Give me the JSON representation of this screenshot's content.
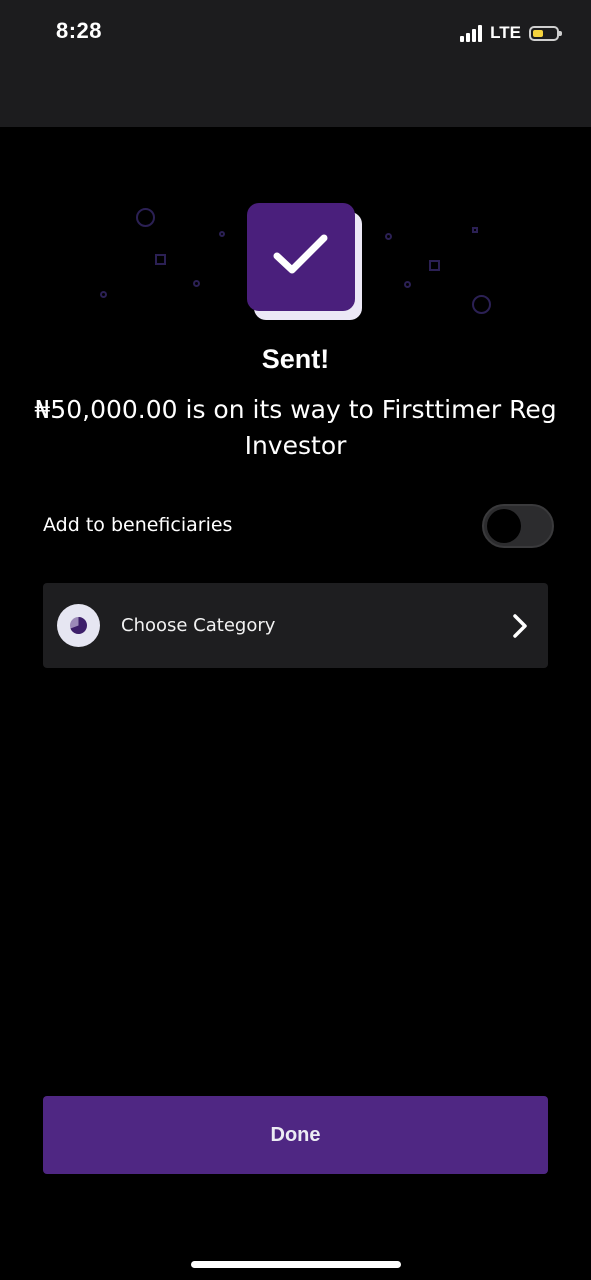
{
  "status_bar": {
    "time": "8:28",
    "network": "LTE",
    "battery_level": 0.45,
    "battery_color": "#f5d33d"
  },
  "hero": {
    "icon": "check-icon",
    "accent_color": "#4a1f7c"
  },
  "title": "Sent!",
  "message": "₦50,000.00 is on its way to Firsttimer Reg Investor",
  "beneficiary": {
    "label": "Add to beneficiaries",
    "enabled": false
  },
  "category": {
    "icon": "pie-chart-icon",
    "label": "Choose Category",
    "chevron": "chevron-right-icon"
  },
  "done_button": {
    "label": "Done",
    "color": "#4f2783"
  }
}
